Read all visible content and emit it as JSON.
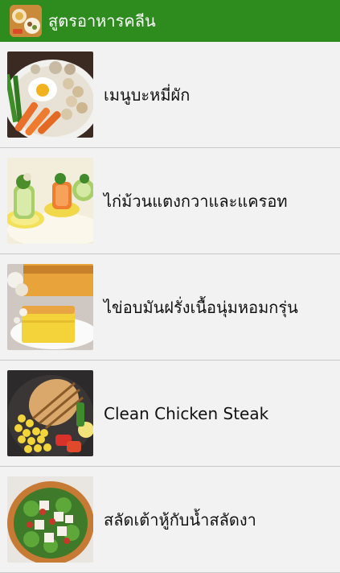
{
  "app": {
    "title": "สูตรอาหารคลีน",
    "icon": "food-bowl-icon",
    "accent": "#2e8b1e"
  },
  "recipes": [
    {
      "title": "เมนูบะหมี่ผัก",
      "image": "noodle-bowl-with-egg-and-carrots"
    },
    {
      "title": "ไก่ม้วนแตงกวาและแครอท",
      "image": "cucumber-carrot-chicken-rolls"
    },
    {
      "title": "ไข่อบมันฝรั่งเนื้อนุ่มหอมกรุ่น",
      "image": "baked-egg-potato-casserole"
    },
    {
      "title": "Clean Chicken Steak",
      "image": "grilled-chicken-with-corn"
    },
    {
      "title": "สลัดเต้าหู้กับน้ำสลัดงา",
      "image": "tofu-salad-bowl"
    }
  ]
}
